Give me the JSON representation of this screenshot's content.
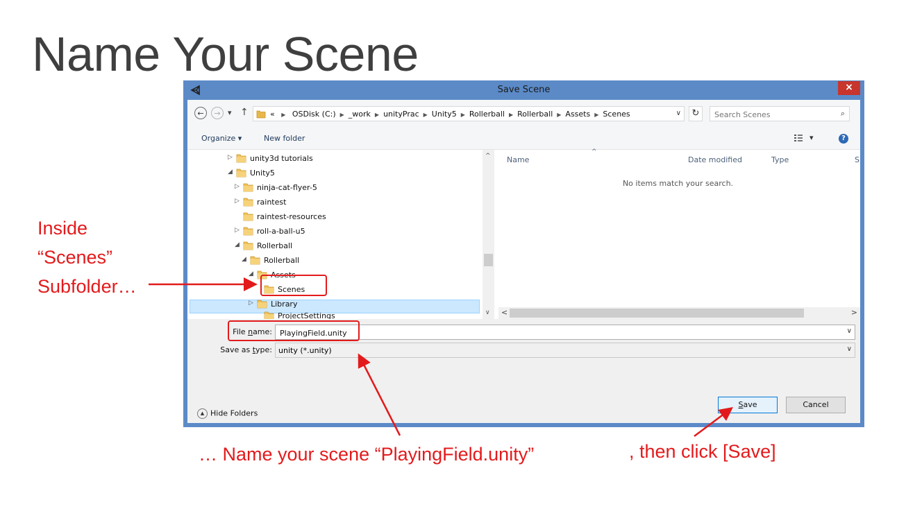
{
  "slide": {
    "title": "Name Your Scene"
  },
  "dialog": {
    "title": "Save Scene",
    "close_label": "×",
    "nav": {
      "back_icon": "back-arrow-icon",
      "forward_icon": "forward-arrow-icon",
      "recent_dropdown": "▾",
      "up_icon": "↑"
    },
    "address": {
      "overflow": "«",
      "crumbs": [
        "OSDisk (C:)",
        "_work",
        "unityPrac",
        "Unity5",
        "Rollerball",
        "Rollerball",
        "Assets",
        "Scenes"
      ],
      "dropdown": "∨"
    },
    "refresh_icon": "↻",
    "search": {
      "placeholder": "Search Scenes",
      "icon": "⌕"
    },
    "toolbar": {
      "organize": "Organize ▾",
      "new_folder": "New folder",
      "view_dropdown": "▾",
      "help": "?"
    },
    "tree": [
      {
        "label": "unity3d tutorials",
        "arrow": "▷"
      },
      {
        "label": "Unity5",
        "arrow": "◢"
      },
      {
        "label": "ninja-cat-flyer-5",
        "arrow": "▷"
      },
      {
        "label": "raintest",
        "arrow": "▷"
      },
      {
        "label": "raintest-resources",
        "arrow": ""
      },
      {
        "label": "roll-a-ball-u5",
        "arrow": "▷"
      },
      {
        "label": "Rollerball",
        "arrow": "◢"
      },
      {
        "label": "Rollerball",
        "arrow": "◢"
      },
      {
        "label": "Assets",
        "arrow": "◢"
      },
      {
        "label": "Scenes",
        "arrow": ""
      },
      {
        "label": "Library",
        "arrow": "▷"
      },
      {
        "label": "ProjectSettings",
        "arrow": ""
      }
    ],
    "tree_scroll": {
      "up": "^",
      "down": "∨"
    },
    "list": {
      "columns": [
        "Name",
        "Date modified",
        "Type",
        "S"
      ],
      "sort_indicator": "^",
      "empty_message": "No items match your search.",
      "scroll_left": "<",
      "scroll_right": ">"
    },
    "file_name": {
      "label_pre": "File ",
      "label_u": "n",
      "label_post": "ame:",
      "value": "PlayingField.unity",
      "dropdown": "∨"
    },
    "save_as_type": {
      "label_pre": "Save as ",
      "label_u": "t",
      "label_post": "ype:",
      "value": "unity (*.unity)",
      "dropdown": "∨"
    },
    "hide_folders": "Hide Folders",
    "save_button": {
      "u": "S",
      "rest": "ave"
    },
    "cancel_button": "Cancel"
  },
  "annotations": {
    "inside": [
      "Inside",
      "“Scenes”",
      "Subfolder…"
    ],
    "name_hint": "… Name your scene “PlayingField.unity”",
    "click_hint": ", then click [Save]",
    "color": "#e31a1c"
  },
  "colors": {
    "window_frame": "#5b8ac7",
    "selection": "#cce8ff",
    "close_button": "#c7352c",
    "title_text": "#3f3f3f"
  }
}
